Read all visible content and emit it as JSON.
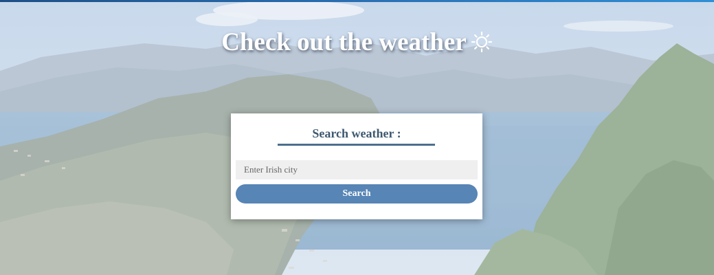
{
  "header": {
    "title": "Check out the weather",
    "icon": "sun-icon"
  },
  "search_card": {
    "heading": "Search weather :",
    "input_placeholder": "Enter Irish city",
    "input_value": "",
    "button_label": "Search"
  },
  "colors": {
    "accent": "#5785b5",
    "heading": "#3d5870",
    "top_bar": "#2a6fb2"
  }
}
